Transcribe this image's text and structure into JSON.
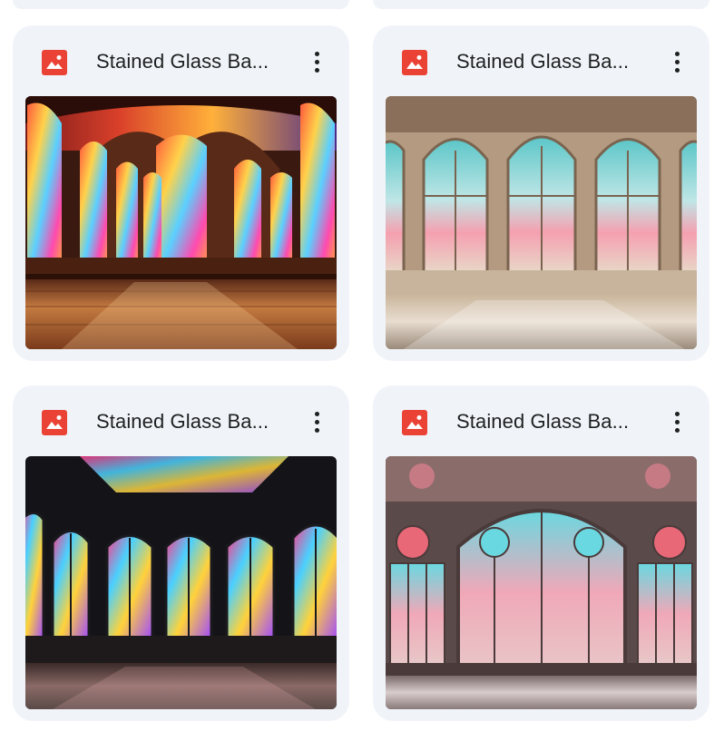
{
  "files": [
    {
      "title": "Stained Glass Ba...",
      "icon": "image-file-icon",
      "icon_color": "#ea4335",
      "theme": "warm-red"
    },
    {
      "title": "Stained Glass Ba...",
      "icon": "image-file-icon",
      "icon_color": "#ea4335",
      "theme": "pastel-cream"
    },
    {
      "title": "Stained Glass Ba...",
      "icon": "image-file-icon",
      "icon_color": "#ea4335",
      "theme": "dark-vivid"
    },
    {
      "title": "Stained Glass Ba...",
      "icon": "image-file-icon",
      "icon_color": "#ea4335",
      "theme": "rose-teal"
    }
  ],
  "more_actions_icon": "more-vert-icon"
}
